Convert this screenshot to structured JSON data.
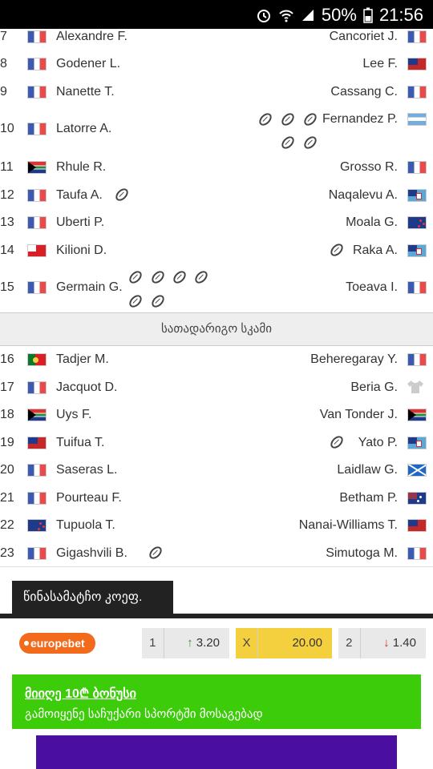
{
  "status_bar": {
    "battery": "50%",
    "time": "21:56"
  },
  "starters": [
    {
      "num": "7",
      "home": "Alexandre F.",
      "home_flag": "fr",
      "away": "Cancoriet J.",
      "away_flag": "fr",
      "home_tries": 0,
      "away_tries": 0
    },
    {
      "num": "8",
      "home": "Godener L.",
      "home_flag": "fr",
      "away": "Lee F.",
      "away_flag": "ws",
      "home_tries": 0,
      "away_tries": 0
    },
    {
      "num": "9",
      "home": "Nanette T.",
      "home_flag": "fr",
      "away": "Cassang C.",
      "away_flag": "fr",
      "home_tries": 0,
      "away_tries": 0
    },
    {
      "num": "10",
      "home": "Latorre A.",
      "home_flag": "fr",
      "away": "Fernandez P.",
      "away_flag": "ar",
      "home_tries": 0,
      "away_tries": 5
    },
    {
      "num": "11",
      "home": "Rhule R.",
      "home_flag": "za",
      "away": "Grosso R.",
      "away_flag": "fr",
      "home_tries": 0,
      "away_tries": 0
    },
    {
      "num": "12",
      "home": "Taufa A.",
      "home_flag": "fr",
      "away": "Naqalevu A.",
      "away_flag": "fj",
      "home_tries": 1,
      "away_tries": 0
    },
    {
      "num": "13",
      "home": "Uberti P.",
      "home_flag": "fr",
      "away": "Moala G.",
      "away_flag": "nz",
      "home_tries": 0,
      "away_tries": 0
    },
    {
      "num": "14",
      "home": "Kilioni D.",
      "home_flag": "to",
      "away": "Raka A.",
      "away_flag": "fj",
      "home_tries": 0,
      "away_tries": 1
    },
    {
      "num": "15",
      "home": "Germain G.",
      "home_flag": "fr",
      "away": "Toeava I.",
      "away_flag": "fr",
      "home_tries": 6,
      "away_tries": 0
    }
  ],
  "bench_header": "სათადარიგო სკამი",
  "bench": [
    {
      "num": "16",
      "home": "Tadjer M.",
      "home_flag": "pt",
      "away": "Beheregaray Y.",
      "away_flag": "fr",
      "home_tries": 0,
      "away_tries": 0
    },
    {
      "num": "17",
      "home": "Jacquot D.",
      "home_flag": "fr",
      "away": "Beria G.",
      "away_flag": "shirt",
      "home_tries": 0,
      "away_tries": 0
    },
    {
      "num": "18",
      "home": "Uys F.",
      "home_flag": "za",
      "away": "Van Tonder J.",
      "away_flag": "za",
      "home_tries": 0,
      "away_tries": 0
    },
    {
      "num": "19",
      "home": "Tuifua T.",
      "home_flag": "ws",
      "away": "Yato P.",
      "away_flag": "fj",
      "home_tries": 0,
      "away_tries": 1
    },
    {
      "num": "20",
      "home": "Saseras L.",
      "home_flag": "fr",
      "away": "Laidlaw G.",
      "away_flag": "sc",
      "home_tries": 0,
      "away_tries": 0
    },
    {
      "num": "21",
      "home": "Pourteau F.",
      "home_flag": "fr",
      "away": "Betham P.",
      "away_flag": "au",
      "home_tries": 0,
      "away_tries": 0
    },
    {
      "num": "22",
      "home": "Tupuola T.",
      "home_flag": "nz",
      "away": "Nanai-Williams T.",
      "away_flag": "ws",
      "home_tries": 0,
      "away_tries": 0
    },
    {
      "num": "23",
      "home": "Gigashvili B.",
      "home_flag": "fr",
      "away": "Simutoga M.",
      "away_flag": "fr",
      "home_tries": 1,
      "away_tries": 0
    }
  ],
  "odds": {
    "tab_label": "წინასამატჩო კოეფ.",
    "brand": "europebet",
    "items": [
      {
        "label": "1",
        "value": "3.20",
        "trend": "up"
      },
      {
        "label": "X",
        "value": "20.00",
        "trend": "none"
      },
      {
        "label": "2",
        "value": "1.40",
        "trend": "down"
      }
    ]
  },
  "banner": {
    "title": "მიიღე 10₾ ბონუსი",
    "subtitle": "გამოიყენე საჩუქარი სპორტში მოსაგებად"
  },
  "colors": {
    "accent_green": "#3ccc0a",
    "odds_highlight": "#f4d03f",
    "brand_orange": "#f26a1b",
    "up": "#2e9e2e",
    "down": "#d32f2f"
  }
}
